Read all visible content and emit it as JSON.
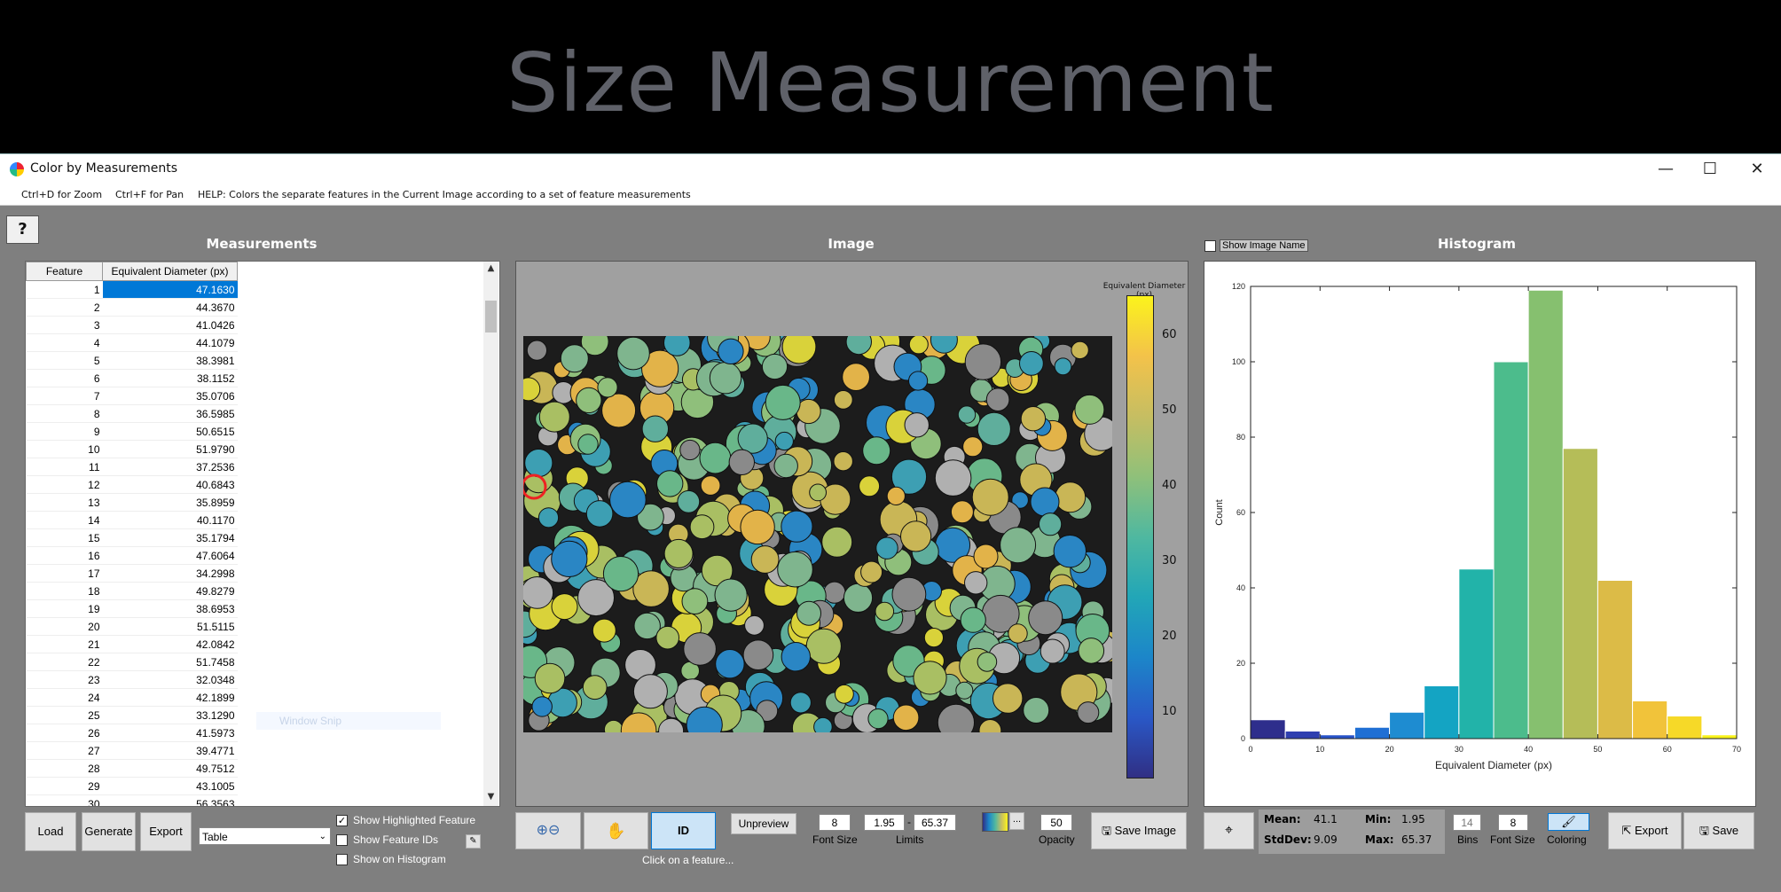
{
  "slide_title": "Size Measurement",
  "window": {
    "title": "Color by Measurements",
    "minimize": "—",
    "maximize": "☐",
    "close": "✕"
  },
  "menubar": {
    "zoom": "Ctrl+D for Zoom",
    "pan": "Ctrl+F for Pan",
    "help": "HELP:  Colors the separate features in the Current Image according to a set of feature measurements"
  },
  "help_button": "?",
  "panels": {
    "measurements": "Measurements",
    "image": "Image",
    "histogram": "Histogram"
  },
  "table": {
    "headers": [
      "Feature",
      "Equivalent Diameter (px)"
    ],
    "selected_row": 1,
    "rows": [
      [
        "1",
        "47.1630"
      ],
      [
        "2",
        "44.3670"
      ],
      [
        "3",
        "41.0426"
      ],
      [
        "4",
        "44.1079"
      ],
      [
        "5",
        "38.3981"
      ],
      [
        "6",
        "38.1152"
      ],
      [
        "7",
        "35.0706"
      ],
      [
        "8",
        "36.5985"
      ],
      [
        "9",
        "50.6515"
      ],
      [
        "10",
        "51.9790"
      ],
      [
        "11",
        "37.2536"
      ],
      [
        "12",
        "40.6843"
      ],
      [
        "13",
        "35.8959"
      ],
      [
        "14",
        "40.1170"
      ],
      [
        "15",
        "35.1794"
      ],
      [
        "16",
        "47.6064"
      ],
      [
        "17",
        "34.2998"
      ],
      [
        "18",
        "49.8279"
      ],
      [
        "19",
        "38.6953"
      ],
      [
        "20",
        "51.5115"
      ],
      [
        "21",
        "42.0842"
      ],
      [
        "22",
        "51.7458"
      ],
      [
        "23",
        "32.0348"
      ],
      [
        "24",
        "42.1899"
      ],
      [
        "25",
        "33.1290"
      ],
      [
        "26",
        "41.5973"
      ],
      [
        "27",
        "39.4771"
      ],
      [
        "28",
        "49.7512"
      ],
      [
        "29",
        "43.1005"
      ],
      [
        "30",
        "56.3563"
      ]
    ]
  },
  "window_snip": "Window Snip",
  "left_controls": {
    "load": "Load",
    "generate": "Generate",
    "export": "Export",
    "format_value": "Table",
    "show_highlighted": "Show Highlighted Feature",
    "show_highlighted_checked": true,
    "show_feature_ids": "Show Feature IDs",
    "show_feature_ids_checked": false,
    "show_on_histogram": "Show on Histogram",
    "show_on_histogram_checked": false
  },
  "image_controls": {
    "zoom_icon": "zoom-in-out-icon",
    "pan_icon": "hand-pan-icon",
    "id_button": "ID",
    "unpreview": "Unpreview",
    "font_size_value": "8",
    "font_size_label": "Font Size",
    "limit_min": "1.95",
    "limit_sep": "-",
    "limit_max": "65.37",
    "limits_label": "Limits",
    "opacity_value": "50",
    "opacity_label": "Opacity",
    "colormap_more": "...",
    "save_image": "Save Image",
    "hint": "Click on a feature..."
  },
  "colorbar": {
    "title": "Equivalent Diameter (px)",
    "ticks": [
      "60",
      "50",
      "40",
      "30",
      "20",
      "10"
    ]
  },
  "hist_controls": {
    "show_image_name": "Show Image Name",
    "show_image_name_checked": false,
    "mean_label": "Mean:",
    "mean_value": "41.1",
    "min_label": "Min:",
    "min_value": "1.95",
    "stddev_label": "StdDev:",
    "stddev_value": "9.09",
    "max_label": "Max:",
    "max_value": "65.37",
    "bins_value": "14",
    "bins_label": "Bins",
    "font_size_value": "8",
    "font_size_label": "Font Size",
    "coloring_label": "Coloring",
    "export": "Export",
    "save": "Save"
  },
  "chart_data": {
    "type": "bar",
    "xlabel": "Equivalent Diameter (px)",
    "ylabel": "Count",
    "xlim": [
      0,
      70
    ],
    "ylim": [
      0,
      120
    ],
    "xticks": [
      0,
      10,
      20,
      30,
      40,
      50,
      60,
      70
    ],
    "yticks": [
      0,
      20,
      40,
      60,
      80,
      100,
      120
    ],
    "bin_edges": [
      0,
      5,
      10,
      15,
      20,
      25,
      30,
      35,
      40,
      45,
      50,
      55,
      60,
      65,
      70
    ],
    "values": [
      5,
      2,
      1,
      3,
      7,
      14,
      45,
      100,
      119,
      77,
      42,
      10,
      6,
      1
    ],
    "colors": [
      "#2e2e8c",
      "#2f3fb0",
      "#2853c8",
      "#1f6fd4",
      "#1e8cd1",
      "#14a4c3",
      "#22b3a9",
      "#4cbc8c",
      "#86c06f",
      "#b5bd58",
      "#dcbb47",
      "#f1c33a",
      "#f6d928",
      "#f8f31a"
    ],
    "grid": false
  }
}
